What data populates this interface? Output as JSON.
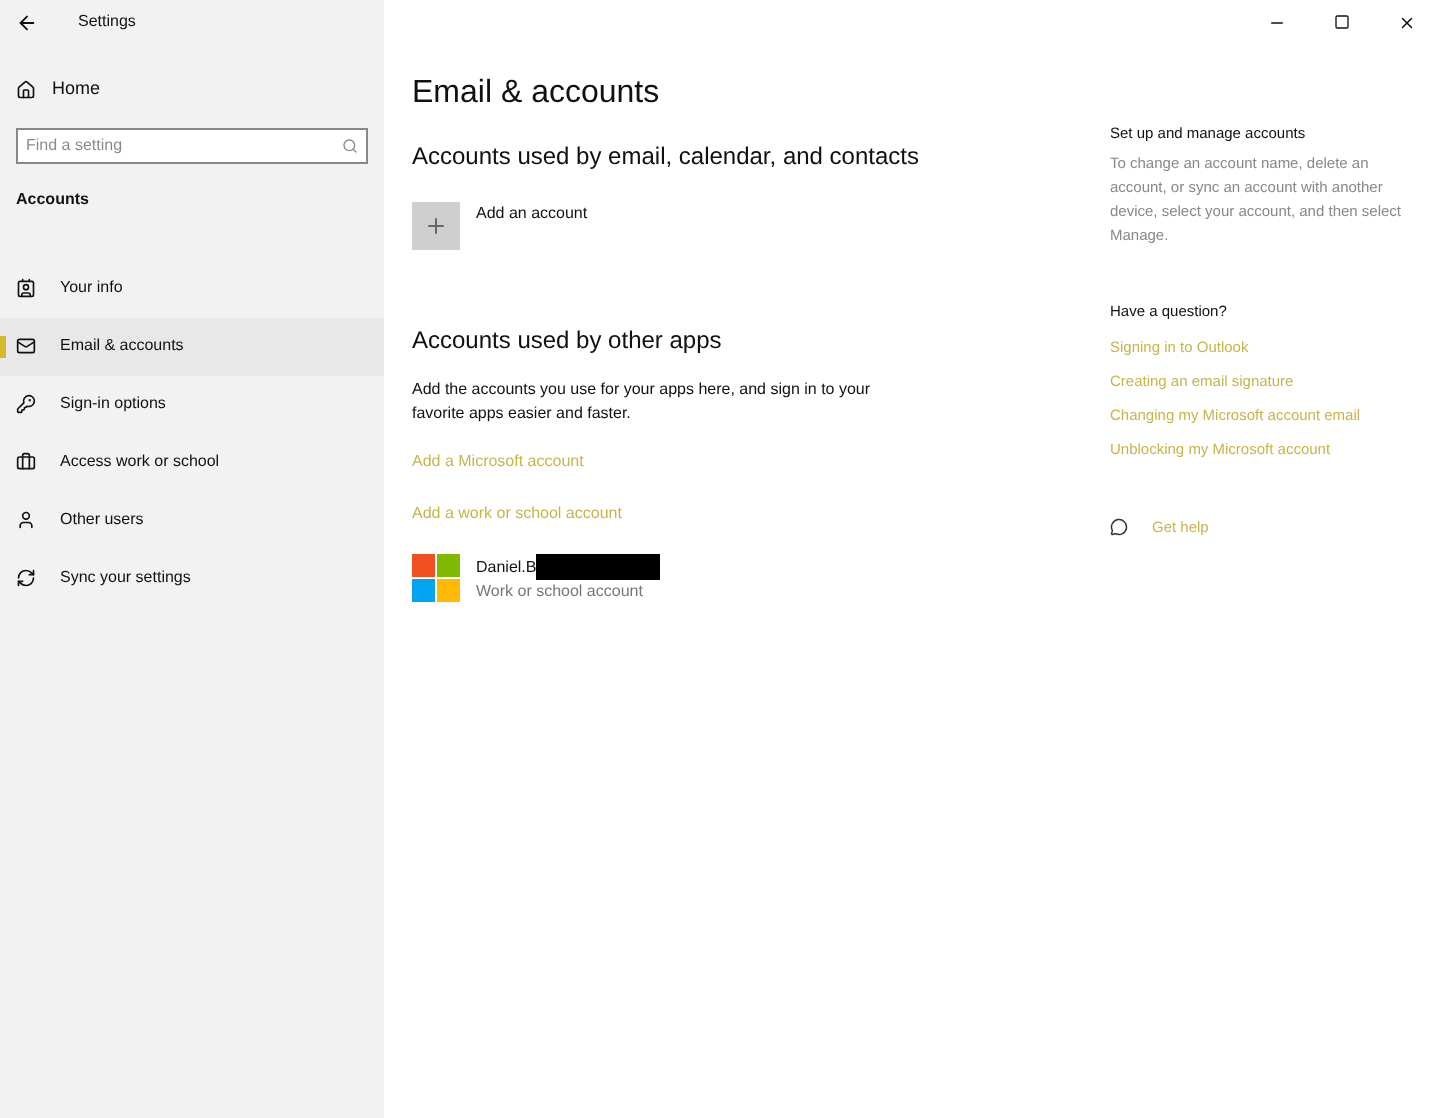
{
  "window": {
    "title": "Settings"
  },
  "sidebar": {
    "home": "Home",
    "search": {
      "placeholder": "Find a setting"
    },
    "section": "Accounts",
    "items": [
      {
        "kind": "info",
        "label": "Your info",
        "selected": false
      },
      {
        "kind": "email",
        "label": "Email & accounts",
        "selected": true
      },
      {
        "kind": "signin",
        "label": "Sign-in options",
        "selected": false
      },
      {
        "kind": "work",
        "label": "Access work or school",
        "selected": false
      },
      {
        "kind": "users",
        "label": "Other users",
        "selected": false
      },
      {
        "kind": "sync",
        "label": "Sync your settings",
        "selected": false
      }
    ]
  },
  "main": {
    "title": "Email & accounts",
    "section1": "Accounts used by email, calendar, and contacts",
    "add_account": "Add an account",
    "section2": "Accounts used by other apps",
    "description": "Add the accounts you use for your apps here, and sign in to your favorite apps easier and faster.",
    "links": [
      "Add a Microsoft account",
      "Add a work or school account"
    ],
    "account": {
      "name": "Daniel.B",
      "type": "Work or school account",
      "redacted": true
    }
  },
  "aside": {
    "title": "Set up and manage accounts",
    "text": "To change an account name, delete an account, or sync an account with another device, select your account, and then select Manage.",
    "question": "Have a question?",
    "links": [
      "Signing in to Outlook",
      "Creating an email signature",
      "Changing my Microsoft account email",
      "Unblocking my Microsoft account"
    ],
    "help": "Get help"
  }
}
